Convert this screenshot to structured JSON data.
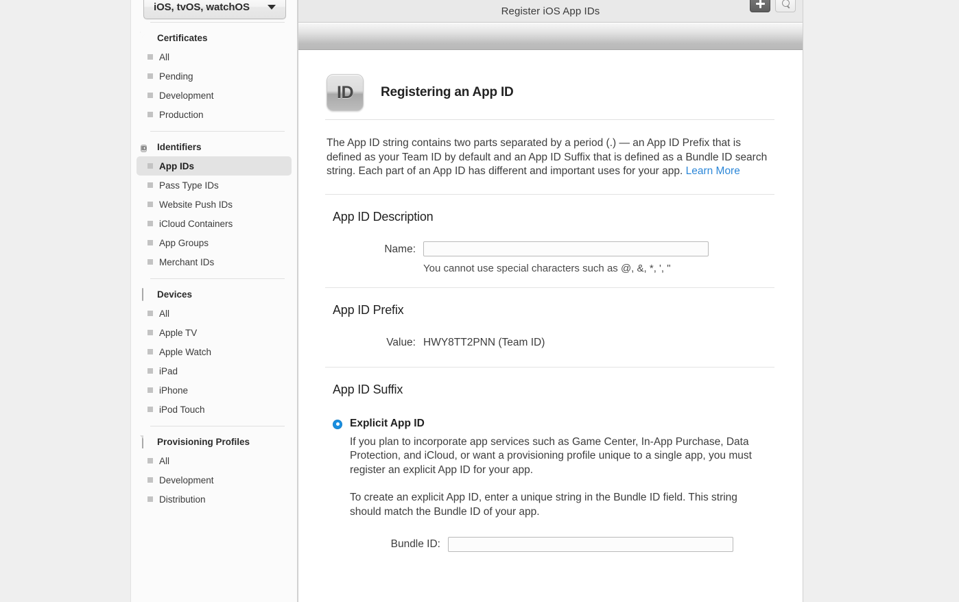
{
  "sidebar": {
    "platform_select": {
      "value": "iOS, tvOS, watchOS",
      "caret": "chevron-down-icon"
    },
    "groups": [
      {
        "id": "certificates",
        "icon": "certificate-seal-icon",
        "label": "Certificates",
        "items": [
          {
            "label": "All",
            "selected": false
          },
          {
            "label": "Pending",
            "selected": false
          },
          {
            "label": "Development",
            "selected": false
          },
          {
            "label": "Production",
            "selected": false
          }
        ]
      },
      {
        "id": "identifiers",
        "icon": "id-badge-icon",
        "label": "Identifiers",
        "items": [
          {
            "label": "App IDs",
            "selected": true
          },
          {
            "label": "Pass Type IDs",
            "selected": false
          },
          {
            "label": "Website Push IDs",
            "selected": false
          },
          {
            "label": "iCloud Containers",
            "selected": false
          },
          {
            "label": "App Groups",
            "selected": false
          },
          {
            "label": "Merchant IDs",
            "selected": false
          }
        ]
      },
      {
        "id": "devices",
        "icon": "device-icon",
        "label": "Devices",
        "items": [
          {
            "label": "All",
            "selected": false
          },
          {
            "label": "Apple TV",
            "selected": false
          },
          {
            "label": "Apple Watch",
            "selected": false
          },
          {
            "label": "iPad",
            "selected": false
          },
          {
            "label": "iPhone",
            "selected": false
          },
          {
            "label": "iPod Touch",
            "selected": false
          }
        ]
      },
      {
        "id": "provisioning-profiles",
        "icon": "document-icon",
        "label": "Provisioning Profiles",
        "items": [
          {
            "label": "All",
            "selected": false
          },
          {
            "label": "Development",
            "selected": false
          },
          {
            "label": "Distribution",
            "selected": false
          }
        ]
      }
    ]
  },
  "main": {
    "titlebar": {
      "title": "Register iOS App IDs",
      "add_button": "+",
      "search_button": "search-icon"
    },
    "hero": {
      "icon_text": "ID",
      "title": "Registering an App ID"
    },
    "intro": {
      "text": "The App ID string contains two parts separated by a period (.) — an App ID Prefix that is defined as your Team ID by default and an App ID Suffix that is defined as a Bundle ID search string. Each part of an App ID has different and important uses for your app. ",
      "link_text": "Learn More"
    },
    "description_section": {
      "title": "App ID Description",
      "name_label": "Name:",
      "name_value": "",
      "name_hint": "You cannot use special characters such as @, &, *, ', \""
    },
    "prefix_section": {
      "title": "App ID Prefix",
      "value_label": "Value:",
      "value": "HWY8TT2PNN (Team ID)"
    },
    "suffix_section": {
      "title": "App ID Suffix",
      "explicit": {
        "radio_state": "selected",
        "title": "Explicit App ID",
        "paragraph_1": "If you plan to incorporate app services such as Game Center, In-App Purchase, Data Protection, and iCloud, or want a provisioning profile unique to a single app, you must register an explicit App ID for your app.",
        "paragraph_2": "To create an explicit App ID, enter a unique string in the Bundle ID field. This string should match the Bundle ID of your app.",
        "bundle_label": "Bundle ID:",
        "bundle_value": ""
      }
    }
  },
  "colors": {
    "accent_link": "#2c87d8",
    "radio_blue": "#1a8fe0",
    "sidebar_bg": "#fbfbfb",
    "page_bg": "#efefef",
    "selected_row": "#e3e3e3"
  }
}
